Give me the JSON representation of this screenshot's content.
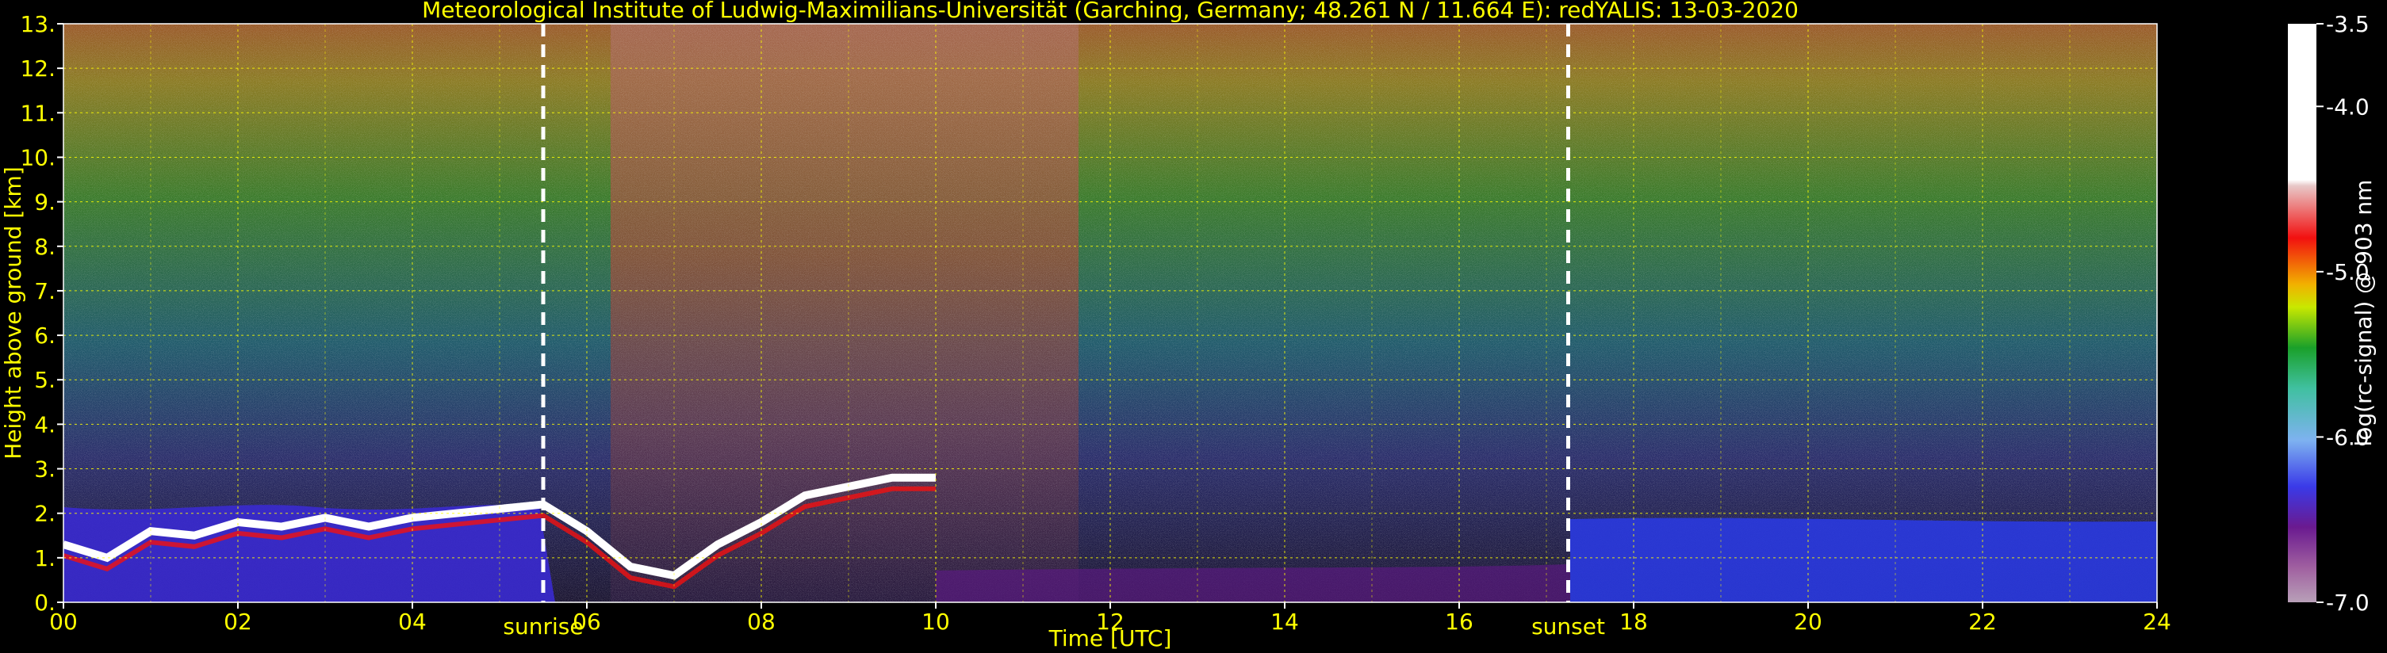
{
  "chart_data": {
    "type": "heatmap",
    "title": "Meteorological Institute of Ludwig-Maximilians-Universität (Garching, Germany; 48.261 N / 11.664 E):    redYALIS: 13-03-2020",
    "xlabel": "Time [UTC]",
    "ylabel": "Height above ground [km]",
    "xlim": [
      0,
      24
    ],
    "ylim": [
      0,
      13
    ],
    "x_tick_labels": [
      "00",
      "02",
      "04",
      "06",
      "08",
      "10",
      "12",
      "14",
      "16",
      "18",
      "20",
      "22",
      "24"
    ],
    "y_tick_labels": [
      "0.",
      "1.",
      "2.",
      "3.",
      "4.",
      "5.",
      "6.",
      "7.",
      "8.",
      "9.",
      "10.",
      "11.",
      "12.",
      "13."
    ],
    "grid": true,
    "annotations": [
      {
        "label": "sunrise",
        "x": 5.5
      },
      {
        "label": "sunset",
        "x": 17.25
      }
    ],
    "colorbar": {
      "label": "log(rc-signal) @ 903 nm",
      "range": [
        -7.0,
        -3.5
      ],
      "tick_labels": [
        "-3.5",
        "-4.0",
        "-5.0",
        "-6.0",
        "-7.0"
      ],
      "tick_values": [
        -3.5,
        -4.0,
        -5.0,
        -6.0,
        -7.0
      ]
    },
    "boundary_layer_top_km": [
      [
        0.0,
        1.3
      ],
      [
        0.5,
        1.0
      ],
      [
        1.0,
        1.6
      ],
      [
        1.5,
        1.5
      ],
      [
        2.0,
        1.8
      ],
      [
        2.5,
        1.7
      ],
      [
        3.0,
        1.9
      ],
      [
        3.5,
        1.7
      ],
      [
        4.0,
        1.9
      ],
      [
        4.5,
        2.0
      ],
      [
        5.0,
        2.1
      ],
      [
        5.5,
        2.2
      ],
      [
        6.0,
        1.6
      ],
      [
        6.5,
        0.8
      ],
      [
        7.0,
        0.6
      ],
      [
        7.5,
        1.3
      ],
      [
        8.0,
        1.8
      ],
      [
        8.5,
        2.4
      ],
      [
        9.0,
        2.6
      ],
      [
        9.5,
        2.8
      ],
      [
        10.0,
        2.8
      ]
    ]
  },
  "colors": {
    "text_accent": "#ffff00",
    "grid": "#ffff00",
    "background": "#000000",
    "colorbar_stops": [
      "#f2f2f2",
      "#e8c8c8",
      "#f21010",
      "#f25000",
      "#f59a00",
      "#f2dd00",
      "#c8e800",
      "#60d060",
      "#1aa02a",
      "#40c0a0",
      "#7eb2f0",
      "#3a4ae8",
      "#1a10b0",
      "#6a1a90",
      "#a060a0",
      "#b8a0b8"
    ]
  }
}
